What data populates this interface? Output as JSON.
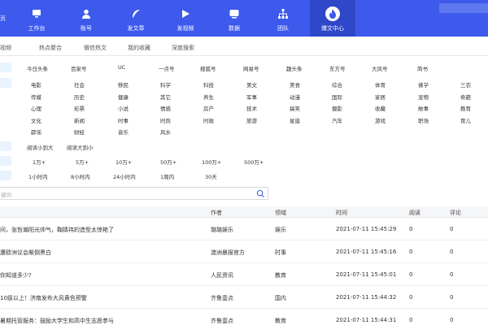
{
  "brand": "页",
  "nav": [
    {
      "label": "工作台",
      "icon": "desktop-icon"
    },
    {
      "label": "账号",
      "icon": "user-icon"
    },
    {
      "label": "发文章",
      "icon": "feather-icon"
    },
    {
      "label": "发视频",
      "icon": "play-icon"
    },
    {
      "label": "数据",
      "icon": "monitor-icon"
    },
    {
      "label": "团队",
      "icon": "team-icon"
    },
    {
      "label": "爆文中心",
      "icon": "fire-icon"
    }
  ],
  "subtabs": [
    "视频",
    "热点聚合",
    "微信热文",
    "我的收藏",
    "深度搜索"
  ],
  "platforms": [
    "今日头条",
    "百家号",
    "UC",
    "一点号",
    "搜狐号",
    "网易号",
    "趣头条",
    "东方号",
    "大风号",
    "简书"
  ],
  "categories": [
    [
      "电影",
      "社会",
      "移民",
      "科学",
      "科技",
      "美文",
      "美食",
      "综合",
      "体育",
      "佛学",
      "三农"
    ],
    [
      "传媒",
      "历史",
      "健康",
      "其它",
      "养生",
      "军事",
      "动漫",
      "国际",
      "家居",
      "宠物",
      "奇葩"
    ],
    [
      "心理",
      "彩票",
      "小说",
      "情感",
      "房产",
      "技术",
      "搞笑",
      "摄影",
      "收藏",
      "故事",
      "教育"
    ],
    [
      "文化",
      "新闻",
      "时事",
      "时尚",
      "时政",
      "旅游",
      "星座",
      "汽车",
      "游戏",
      "职场",
      "育儿"
    ],
    [
      "辟谣",
      "财经",
      "音乐",
      "风水"
    ]
  ],
  "sort_options": [
    "阅读小到大",
    "阅读大到小"
  ],
  "read_filters": [
    "1万+",
    "5万+",
    "10万+",
    "50万+",
    "100万+",
    "500万+"
  ],
  "time_filters": [
    "1小时内",
    "8小时内",
    "24小时内",
    "1周内",
    "30天"
  ],
  "search": {
    "placeholder": "键词"
  },
  "table": {
    "columns": [
      "作者",
      "领域",
      "时间",
      "阅读",
      "评论"
    ],
    "rows": [
      {
        "title": "间，张哲瀚阳光帅气，鞠婧祎的造型太惊艳了",
        "author": "璐璐娱乐",
        "domain": "娱乐",
        "time": "2021-07-11 15:45:29",
        "reads": "0",
        "comments": "0"
      },
      {
        "title": "遭欧洲议会飙倒黑白",
        "author": "澳洲晨报官方",
        "domain": "时事",
        "time": "2021-07-11 15:45:16",
        "reads": "0",
        "comments": "0"
      },
      {
        "title": "你知道多少?",
        "author": "人民资讯",
        "domain": "教育",
        "time": "2021-07-11 15:45:01",
        "reads": "0",
        "comments": "0"
      },
      {
        "title": "10级以上！济南发布大风黄色预警",
        "author": "齐鲁壹点",
        "domain": "国内",
        "time": "2021-07-11 15:44:32",
        "reads": "0",
        "comments": "0"
      },
      {
        "title": "暑期托管服务：鼓励大学生和高中生志愿参与",
        "author": "齐鲁壹点",
        "domain": "教育",
        "time": "2021-07-11 15:44:31",
        "reads": "0",
        "comments": "0"
      }
    ]
  },
  "colors": {
    "nav_bg": "#3d5aec",
    "nav_active": "#2f47c9",
    "accent": "#3e5fe8",
    "label_bg": "#e8f3ff"
  }
}
